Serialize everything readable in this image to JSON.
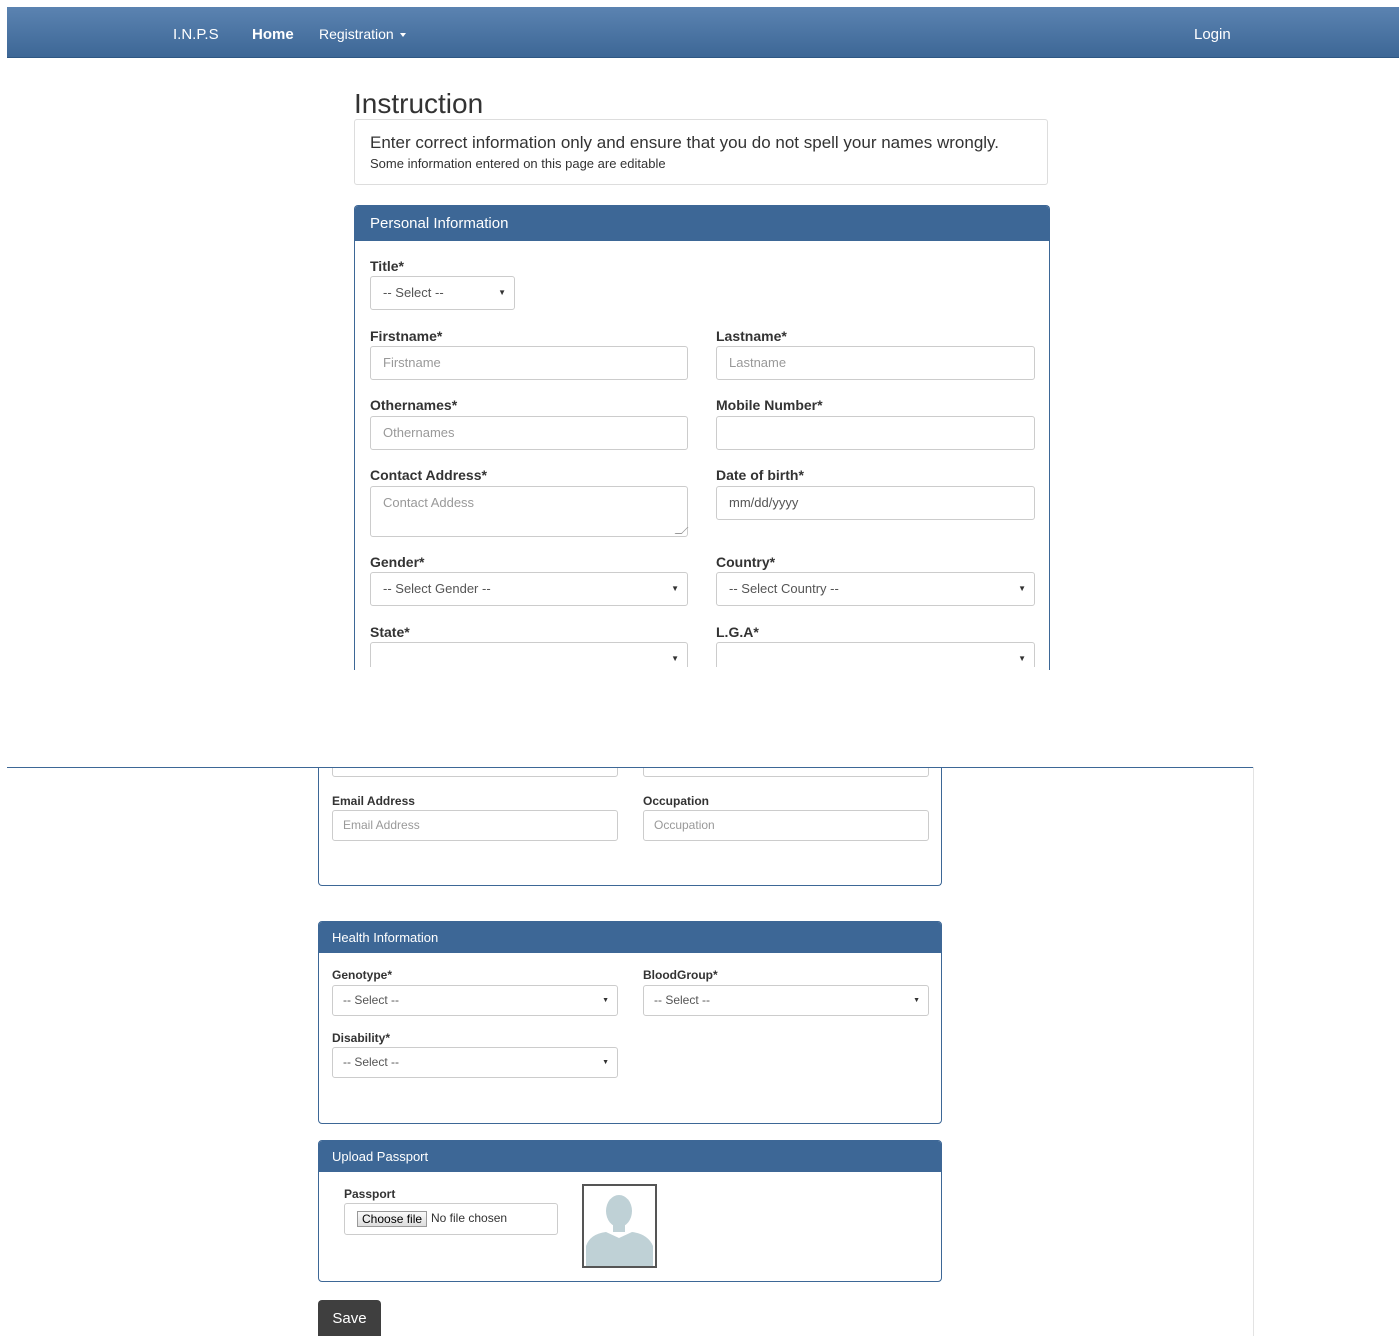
{
  "navbar": {
    "brand": "I.N.P.S",
    "home": "Home",
    "registration": "Registration",
    "login": "Login"
  },
  "instruction": {
    "title": "Instruction",
    "main": "Enter correct information only and ensure that you do not spell your names wrongly.",
    "sub": "Some information entered on this page are editable"
  },
  "personal": {
    "heading": "Personal Information",
    "title_label": "Title*",
    "title_value": "-- Select --",
    "firstname_label": "Firstname*",
    "firstname_placeholder": "Firstname",
    "lastname_label": "Lastname*",
    "lastname_placeholder": "Lastname",
    "othernames_label": "Othernames*",
    "othernames_placeholder": "Othernames",
    "mobile_label": "Mobile Number*",
    "address_label": "Contact Address*",
    "address_placeholder": "Contact Addess",
    "dob_label": "Date of birth*",
    "dob_value": "mm/dd/yyyy",
    "gender_label": "Gender*",
    "gender_value": "-- Select Gender --",
    "country_label": "Country*",
    "country_value": "-- Select Country --",
    "state_label": "State*",
    "lga_label": "L.G.A*",
    "email_label": "Email Address",
    "email_placeholder": "Email Address",
    "occupation_label": "Occupation",
    "occupation_placeholder": "Occupation"
  },
  "health": {
    "heading": "Health Information",
    "genotype_label": "Genotype*",
    "genotype_value": "-- Select --",
    "bloodgroup_label": "BloodGroup*",
    "bloodgroup_value": "-- Select --",
    "disability_label": "Disability*",
    "disability_value": "-- Select --"
  },
  "passport": {
    "heading": "Upload Passport",
    "label": "Passport",
    "choose_file": "Choose file",
    "no_file": "No file chosen"
  },
  "save": "Save",
  "colors": {
    "primary": "#3d6796",
    "save_bg": "#3f3f3f"
  }
}
